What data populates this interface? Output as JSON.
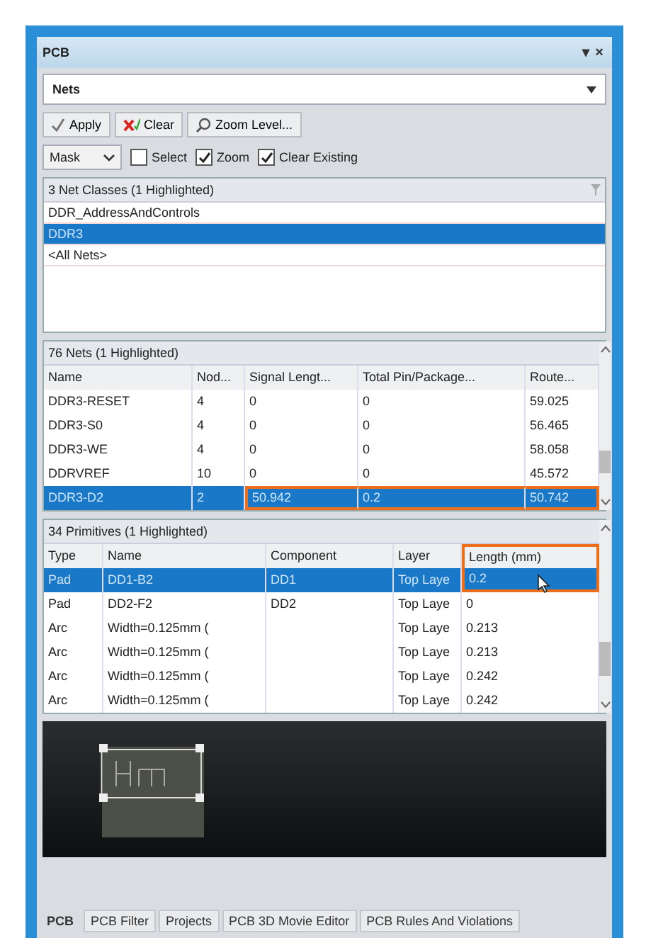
{
  "panel": {
    "title": "PCB",
    "controls": [
      "▾",
      "×"
    ]
  },
  "mode_dropdown": {
    "value": "Nets"
  },
  "buttons": [
    {
      "label": "Apply"
    },
    {
      "label": "Clear"
    },
    {
      "label": "Zoom Level..."
    }
  ],
  "mask_dropdown": {
    "value": "Mask"
  },
  "options": [
    {
      "label": "Select",
      "checked": false
    },
    {
      "label": "Zoom",
      "checked": true
    },
    {
      "label": "Clear Existing",
      "checked": true
    }
  ],
  "net_classes": {
    "header": "3 Net Classes (1 Highlighted)",
    "items": [
      {
        "label": "DDR_AddressAndControls",
        "selected": false
      },
      {
        "label": "DDR3",
        "selected": true
      },
      {
        "label": "<All Nets>",
        "selected": false
      }
    ]
  },
  "nets": {
    "header": "76 Nets (1 Highlighted)",
    "columns": [
      {
        "label": "Name",
        "outlined": false
      },
      {
        "label": "Nod...",
        "outlined": false
      },
      {
        "label": "Signal Lengt...",
        "outlined": true
      },
      {
        "label": "Total Pin/Package...",
        "outlined": true
      },
      {
        "label": "Route...",
        "outlined": true
      }
    ],
    "rows": [
      {
        "cells": [
          "DDR3-RESET",
          "4",
          "0",
          "0",
          "59.025"
        ],
        "selected": false
      },
      {
        "cells": [
          "DDR3-S0",
          "4",
          "0",
          "0",
          "56.465"
        ],
        "selected": false
      },
      {
        "cells": [
          "DDR3-WE",
          "4",
          "0",
          "0",
          "58.058"
        ],
        "selected": false
      },
      {
        "cells": [
          "DDRVREF",
          "10",
          "0",
          "0",
          "45.572"
        ],
        "selected": false
      },
      {
        "cells": [
          "DDR3-D2",
          "2",
          "50.942",
          "0.2",
          "50.742"
        ],
        "selected": true
      }
    ]
  },
  "primitives": {
    "header": "34 Primitives (1 Highlighted)",
    "columns": [
      {
        "label": "Type",
        "outlined": false
      },
      {
        "label": "Name",
        "outlined": false
      },
      {
        "label": "Component",
        "outlined": false
      },
      {
        "label": "Layer",
        "outlined": false
      },
      {
        "label": "Length (mm)",
        "outlined": true
      }
    ],
    "rows": [
      {
        "cells": [
          "Pad",
          "DD1-B2",
          "DD1",
          "Top Laye",
          "0.2"
        ],
        "selected": true
      },
      {
        "cells": [
          "Pad",
          "DD2-F2",
          "DD2",
          "Top Laye",
          "0"
        ],
        "selected": false
      },
      {
        "cells": [
          "Arc",
          "Width=0.125mm (",
          "",
          "Top Laye",
          "0.213"
        ],
        "selected": false
      },
      {
        "cells": [
          "Arc",
          "Width=0.125mm (",
          "",
          "Top Laye",
          "0.213"
        ],
        "selected": false
      },
      {
        "cells": [
          "Arc",
          "Width=0.125mm (",
          "",
          "Top Laye",
          "0.242"
        ],
        "selected": false
      },
      {
        "cells": [
          "Arc",
          "Width=0.125mm (",
          "",
          "Top Laye",
          "0.242"
        ],
        "selected": false
      }
    ]
  },
  "tabs": [
    {
      "label": "PCB",
      "selected": true
    },
    {
      "label": "PCB Filter",
      "selected": false
    },
    {
      "label": "Projects",
      "selected": false
    },
    {
      "label": "PCB 3D Movie Editor",
      "selected": false
    },
    {
      "label": "PCB Rules And Violations",
      "selected": false
    }
  ]
}
